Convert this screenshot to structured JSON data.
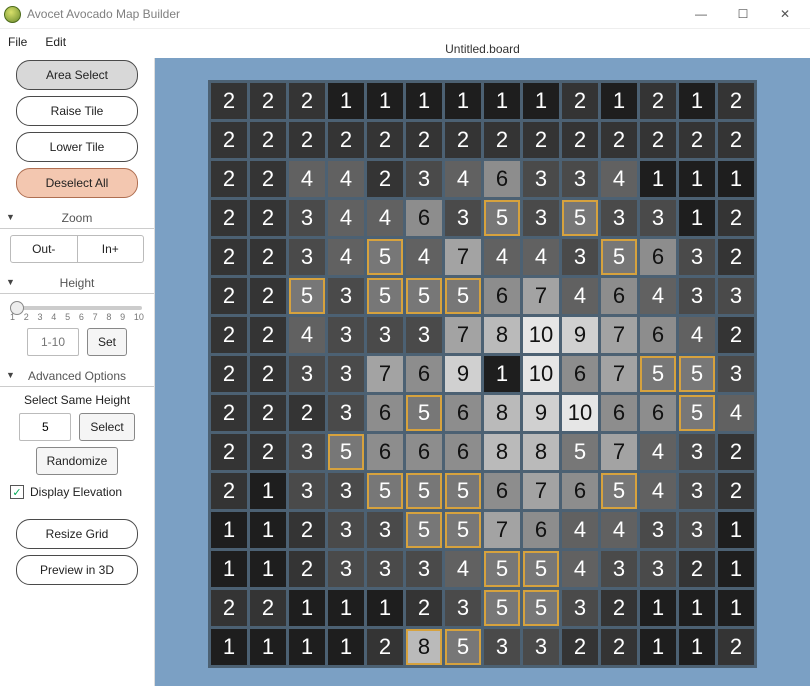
{
  "window": {
    "title": "Avocet Avocado Map Builder",
    "doc": "Untitled.board",
    "min": "—",
    "max": "☐",
    "close": "✕"
  },
  "menu": {
    "file": "File",
    "edit": "Edit"
  },
  "tools": {
    "area_select": "Area Select",
    "raise": "Raise Tile",
    "lower": "Lower Tile",
    "deselect": "Deselect All"
  },
  "zoom": {
    "title": "Zoom",
    "out": "Out-",
    "in": "In+"
  },
  "height": {
    "title": "Height",
    "ticks": [
      "1",
      "2",
      "3",
      "4",
      "5",
      "6",
      "7",
      "8",
      "9",
      "10"
    ],
    "input": "1-10",
    "set": "Set"
  },
  "adv": {
    "title": "Advanced Options",
    "ssh": "Select Same Height",
    "ssh_val": "5",
    "select": "Select",
    "randomize": "Randomize",
    "display_elev": "Display Elevation",
    "display_elev_checked": true,
    "resize": "Resize Grid",
    "preview": "Preview in 3D"
  },
  "grid": {
    "cols": 14,
    "cells": [
      [
        2,
        2,
        2,
        1,
        1,
        1,
        1,
        1,
        1,
        2,
        1,
        2,
        1,
        2
      ],
      [
        2,
        2,
        2,
        2,
        2,
        2,
        2,
        2,
        2,
        2,
        2,
        2,
        2,
        2
      ],
      [
        2,
        2,
        4,
        4,
        2,
        3,
        4,
        6,
        3,
        3,
        4,
        1,
        1,
        1
      ],
      [
        2,
        2,
        3,
        4,
        4,
        6,
        3,
        5,
        3,
        5,
        3,
        3,
        1,
        2
      ],
      [
        2,
        2,
        3,
        4,
        5,
        4,
        7,
        4,
        4,
        3,
        5,
        6,
        3,
        2
      ],
      [
        2,
        2,
        5,
        3,
        5,
        5,
        5,
        6,
        7,
        4,
        6,
        4,
        3,
        3
      ],
      [
        2,
        2,
        4,
        3,
        3,
        3,
        7,
        8,
        10,
        9,
        7,
        6,
        4,
        2
      ],
      [
        2,
        2,
        3,
        3,
        7,
        6,
        9,
        1,
        10,
        6,
        7,
        5,
        5,
        3
      ],
      [
        2,
        2,
        2,
        3,
        6,
        5,
        6,
        8,
        9,
        10,
        6,
        6,
        5,
        4
      ],
      [
        2,
        2,
        3,
        5,
        6,
        6,
        6,
        8,
        8,
        5,
        7,
        4,
        3,
        2
      ],
      [
        2,
        1,
        3,
        3,
        5,
        5,
        5,
        6,
        7,
        6,
        5,
        4,
        3,
        2
      ],
      [
        1,
        1,
        2,
        3,
        3,
        5,
        5,
        7,
        6,
        4,
        4,
        3,
        3,
        1
      ],
      [
        1,
        1,
        2,
        3,
        3,
        3,
        4,
        5,
        5,
        4,
        3,
        3,
        2,
        1
      ],
      [
        2,
        2,
        1,
        1,
        1,
        2,
        3,
        5,
        5,
        3,
        2,
        1,
        1,
        1
      ],
      [
        1,
        1,
        1,
        1,
        2,
        8,
        5,
        3,
        3,
        2,
        2,
        1,
        1,
        2
      ]
    ],
    "selected": [
      [
        3,
        7
      ],
      [
        3,
        9
      ],
      [
        4,
        4
      ],
      [
        4,
        10
      ],
      [
        5,
        2
      ],
      [
        5,
        4
      ],
      [
        5,
        5
      ],
      [
        5,
        6
      ],
      [
        7,
        11
      ],
      [
        7,
        12
      ],
      [
        8,
        5
      ],
      [
        8,
        12
      ],
      [
        9,
        3
      ],
      [
        10,
        4
      ],
      [
        10,
        5
      ],
      [
        10,
        6
      ],
      [
        10,
        10
      ],
      [
        11,
        5
      ],
      [
        11,
        6
      ],
      [
        12,
        7
      ],
      [
        12,
        8
      ],
      [
        13,
        7
      ],
      [
        13,
        8
      ],
      [
        14,
        5
      ],
      [
        14,
        6
      ]
    ]
  }
}
